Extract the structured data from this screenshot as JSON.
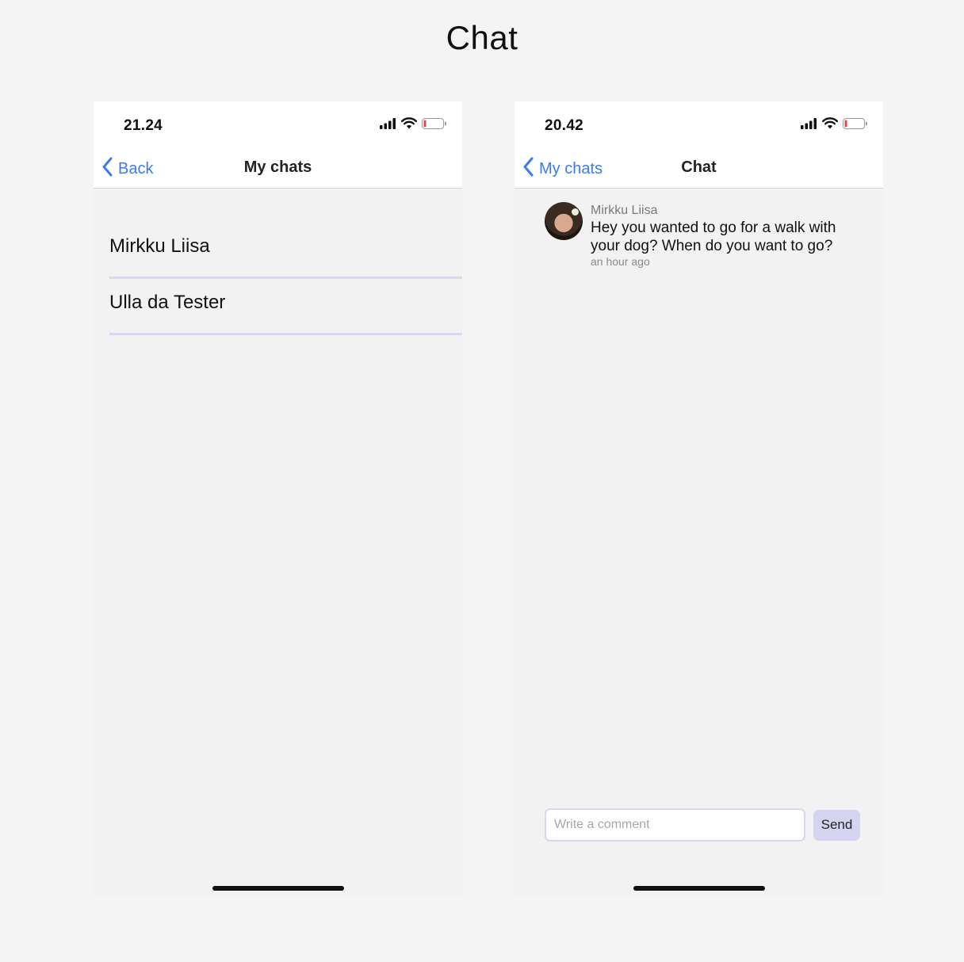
{
  "page": {
    "title": "Chat"
  },
  "screens": {
    "left": {
      "status_time": "21.24",
      "nav": {
        "back_label": "Back",
        "title": "My chats"
      },
      "chats": [
        {
          "name": "Mirkku Liisa"
        },
        {
          "name": "Ulla da Tester"
        }
      ]
    },
    "right": {
      "status_time": "20.42",
      "nav": {
        "back_label": "My chats",
        "title": "Chat"
      },
      "messages": [
        {
          "sender": "Mirkku Liisa",
          "text": "Hey you wanted to go for a walk with your dog? When do you want to go?",
          "time": "an hour ago"
        }
      ],
      "composer": {
        "placeholder": "Write a comment",
        "value": "",
        "send_label": "Send"
      }
    }
  },
  "icons": {
    "signal": "signal-icon",
    "wifi": "wifi-icon",
    "battery": "battery-low-icon",
    "back": "chevron-left-icon"
  },
  "colors": {
    "accent": "#3c7be8",
    "divider": "#d7d7ee",
    "send_button": "#d4d4f0",
    "battery_low": "#e0463e"
  }
}
